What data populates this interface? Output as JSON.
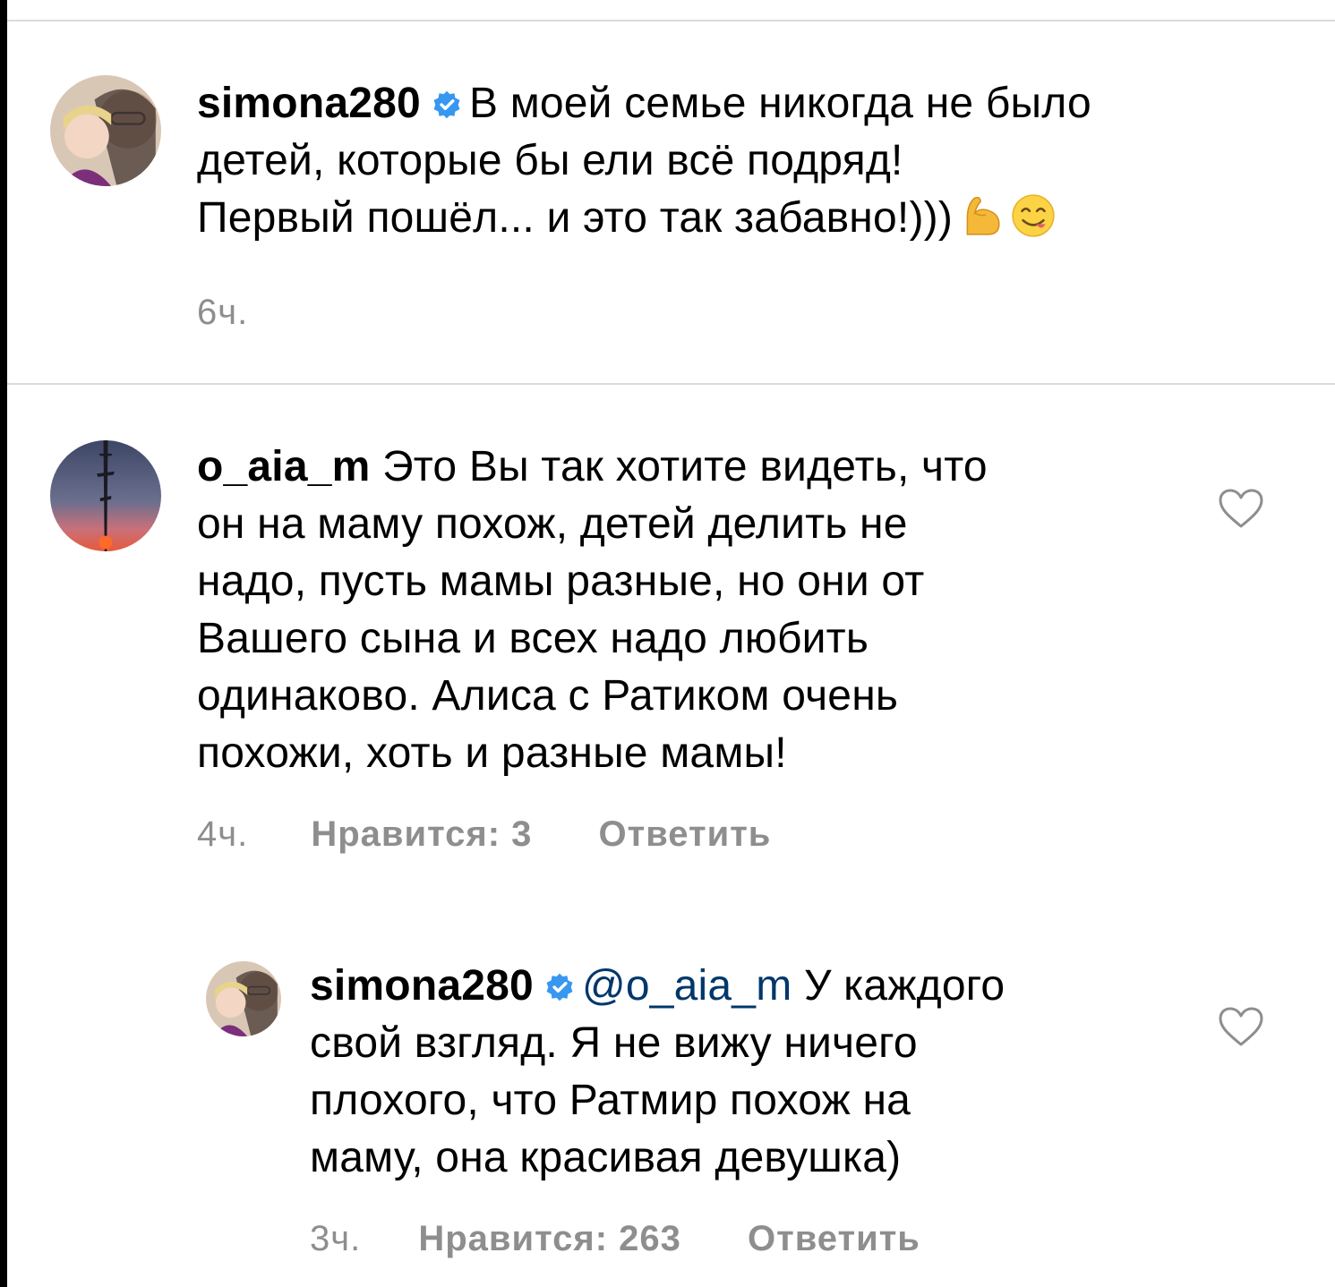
{
  "comments": [
    {
      "username": "simona280",
      "verified": true,
      "line1": "В моей семье никогда не было",
      "line2": "детей, которые бы ели всё подряд!",
      "line3": "Первый пошёл... и это так забавно!)))",
      "emojis": [
        "flexed-biceps",
        "yum-face"
      ],
      "time": "6ч."
    },
    {
      "username": "o_aia_m",
      "verified": false,
      "line1": "Это Вы так хотите видеть, что",
      "lines": [
        "он на маму похож, детей делить не",
        "надо, пусть мамы разные, но они от",
        "Вашего сына и всех надо любить",
        "одинаково. Алиса с Ратиком очень",
        "похожи, хоть и разные мамы!"
      ],
      "time": "4ч.",
      "likes": "Нравится: 3",
      "reply": "Ответить"
    },
    {
      "username": "simona280",
      "verified": true,
      "mention": "@o_aia_m",
      "line1": "У каждого",
      "lines": [
        "свой взгляд. Я не вижу ничего",
        "плохого, что Ратмир похож на",
        "маму, она красивая девушка)"
      ],
      "time": "3ч.",
      "likes": "Нравится: 263",
      "reply": "Ответить"
    }
  ],
  "colors": {
    "text": "#262626",
    "meta": "#8e8e8e",
    "mention": "#00376b",
    "verified": "#3897f0",
    "divider": "#dbdbdb"
  }
}
